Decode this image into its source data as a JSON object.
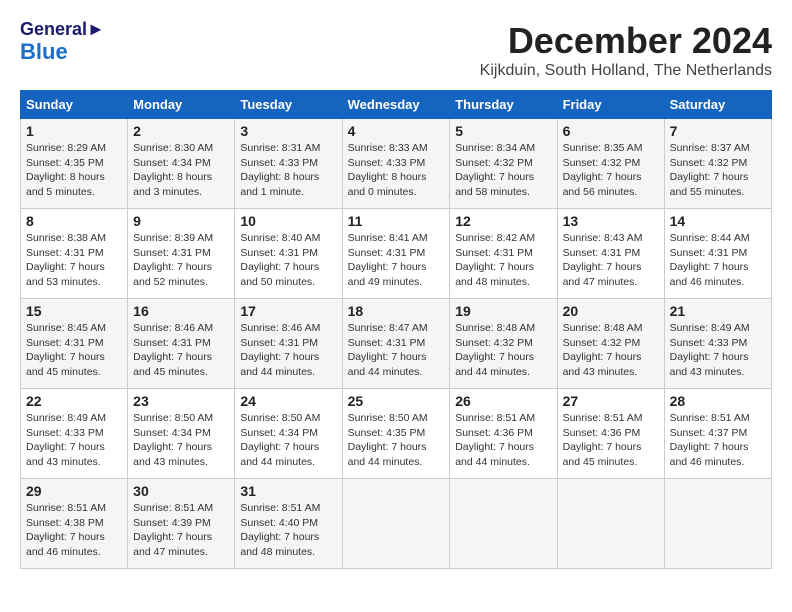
{
  "header": {
    "logo_line1": "General",
    "logo_line2": "Blue",
    "month_title": "December 2024",
    "location": "Kijkduin, South Holland, The Netherlands"
  },
  "weekdays": [
    "Sunday",
    "Monday",
    "Tuesday",
    "Wednesday",
    "Thursday",
    "Friday",
    "Saturday"
  ],
  "weeks": [
    [
      {
        "day": "1",
        "sunrise": "8:29 AM",
        "sunset": "4:35 PM",
        "daylight": "8 hours and 5 minutes"
      },
      {
        "day": "2",
        "sunrise": "8:30 AM",
        "sunset": "4:34 PM",
        "daylight": "8 hours and 3 minutes"
      },
      {
        "day": "3",
        "sunrise": "8:31 AM",
        "sunset": "4:33 PM",
        "daylight": "8 hours and 1 minute"
      },
      {
        "day": "4",
        "sunrise": "8:33 AM",
        "sunset": "4:33 PM",
        "daylight": "8 hours and 0 minutes"
      },
      {
        "day": "5",
        "sunrise": "8:34 AM",
        "sunset": "4:32 PM",
        "daylight": "7 hours and 58 minutes"
      },
      {
        "day": "6",
        "sunrise": "8:35 AM",
        "sunset": "4:32 PM",
        "daylight": "7 hours and 56 minutes"
      },
      {
        "day": "7",
        "sunrise": "8:37 AM",
        "sunset": "4:32 PM",
        "daylight": "7 hours and 55 minutes"
      }
    ],
    [
      {
        "day": "8",
        "sunrise": "8:38 AM",
        "sunset": "4:31 PM",
        "daylight": "7 hours and 53 minutes"
      },
      {
        "day": "9",
        "sunrise": "8:39 AM",
        "sunset": "4:31 PM",
        "daylight": "7 hours and 52 minutes"
      },
      {
        "day": "10",
        "sunrise": "8:40 AM",
        "sunset": "4:31 PM",
        "daylight": "7 hours and 50 minutes"
      },
      {
        "day": "11",
        "sunrise": "8:41 AM",
        "sunset": "4:31 PM",
        "daylight": "7 hours and 49 minutes"
      },
      {
        "day": "12",
        "sunrise": "8:42 AM",
        "sunset": "4:31 PM",
        "daylight": "7 hours and 48 minutes"
      },
      {
        "day": "13",
        "sunrise": "8:43 AM",
        "sunset": "4:31 PM",
        "daylight": "7 hours and 47 minutes"
      },
      {
        "day": "14",
        "sunrise": "8:44 AM",
        "sunset": "4:31 PM",
        "daylight": "7 hours and 46 minutes"
      }
    ],
    [
      {
        "day": "15",
        "sunrise": "8:45 AM",
        "sunset": "4:31 PM",
        "daylight": "7 hours and 45 minutes"
      },
      {
        "day": "16",
        "sunrise": "8:46 AM",
        "sunset": "4:31 PM",
        "daylight": "7 hours and 45 minutes"
      },
      {
        "day": "17",
        "sunrise": "8:46 AM",
        "sunset": "4:31 PM",
        "daylight": "7 hours and 44 minutes"
      },
      {
        "day": "18",
        "sunrise": "8:47 AM",
        "sunset": "4:31 PM",
        "daylight": "7 hours and 44 minutes"
      },
      {
        "day": "19",
        "sunrise": "8:48 AM",
        "sunset": "4:32 PM",
        "daylight": "7 hours and 44 minutes"
      },
      {
        "day": "20",
        "sunrise": "8:48 AM",
        "sunset": "4:32 PM",
        "daylight": "7 hours and 43 minutes"
      },
      {
        "day": "21",
        "sunrise": "8:49 AM",
        "sunset": "4:33 PM",
        "daylight": "7 hours and 43 minutes"
      }
    ],
    [
      {
        "day": "22",
        "sunrise": "8:49 AM",
        "sunset": "4:33 PM",
        "daylight": "7 hours and 43 minutes"
      },
      {
        "day": "23",
        "sunrise": "8:50 AM",
        "sunset": "4:34 PM",
        "daylight": "7 hours and 43 minutes"
      },
      {
        "day": "24",
        "sunrise": "8:50 AM",
        "sunset": "4:34 PM",
        "daylight": "7 hours and 44 minutes"
      },
      {
        "day": "25",
        "sunrise": "8:50 AM",
        "sunset": "4:35 PM",
        "daylight": "7 hours and 44 minutes"
      },
      {
        "day": "26",
        "sunrise": "8:51 AM",
        "sunset": "4:36 PM",
        "daylight": "7 hours and 44 minutes"
      },
      {
        "day": "27",
        "sunrise": "8:51 AM",
        "sunset": "4:36 PM",
        "daylight": "7 hours and 45 minutes"
      },
      {
        "day": "28",
        "sunrise": "8:51 AM",
        "sunset": "4:37 PM",
        "daylight": "7 hours and 46 minutes"
      }
    ],
    [
      {
        "day": "29",
        "sunrise": "8:51 AM",
        "sunset": "4:38 PM",
        "daylight": "7 hours and 46 minutes"
      },
      {
        "day": "30",
        "sunrise": "8:51 AM",
        "sunset": "4:39 PM",
        "daylight": "7 hours and 47 minutes"
      },
      {
        "day": "31",
        "sunrise": "8:51 AM",
        "sunset": "4:40 PM",
        "daylight": "7 hours and 48 minutes"
      },
      null,
      null,
      null,
      null
    ]
  ],
  "labels": {
    "sunrise": "Sunrise:",
    "sunset": "Sunset:",
    "daylight": "Daylight:"
  }
}
